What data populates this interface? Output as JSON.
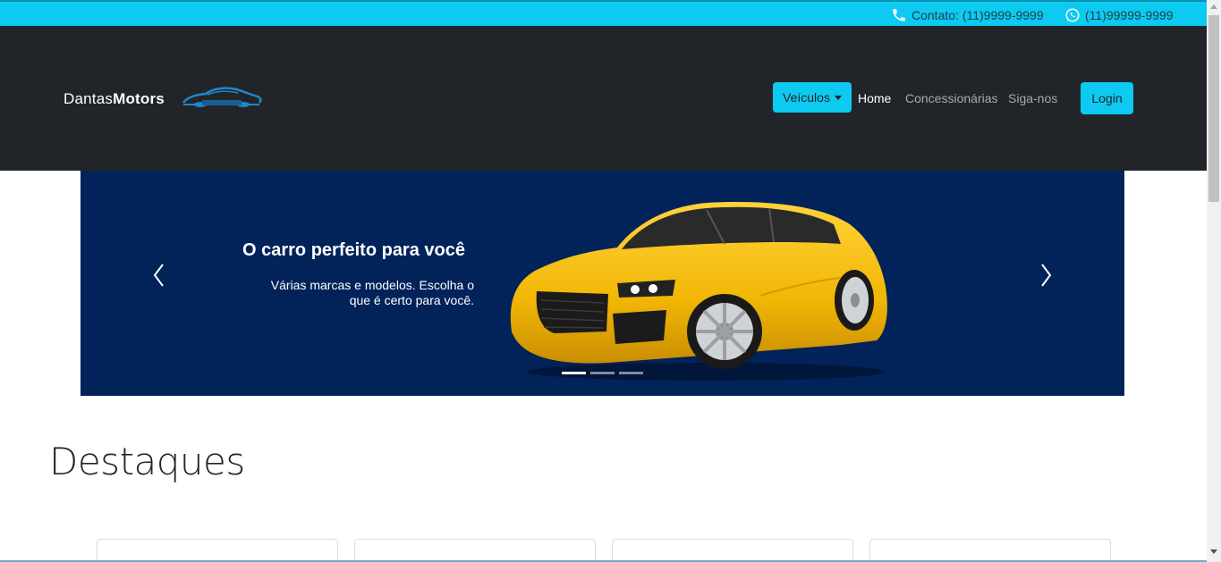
{
  "topbar": {
    "contact_label": "Contato: (11)9999-9999",
    "whatsapp_label": "(11)99999-9999",
    "phone_icon": "phone-icon",
    "whatsapp_icon": "whatsapp-icon"
  },
  "navbar": {
    "brand_light": "Dantas",
    "brand_bold": "Motors",
    "brand_logo_icon": "car-outline-icon",
    "vehicles_dropdown": "Veículos",
    "links": [
      {
        "label": "Home",
        "active": true
      },
      {
        "label": "Concessionárias",
        "active": false
      },
      {
        "label": "Siga-nos",
        "active": false
      }
    ],
    "login_label": "Login"
  },
  "carousel": {
    "title": "O carro perfeito para você",
    "text": "Várias marcas e modelos. Escolha o que é certo para você.",
    "prev_icon": "chevron-left-icon",
    "next_icon": "chevron-right-icon",
    "indicator_count": 3,
    "active_indicator": 0
  },
  "section": {
    "title": "Destaques"
  },
  "colors": {
    "accent": "#0dcaf0",
    "navbar_bg": "#212529",
    "carousel_bg": "#02225a",
    "car_yellow": "#f2b705"
  }
}
